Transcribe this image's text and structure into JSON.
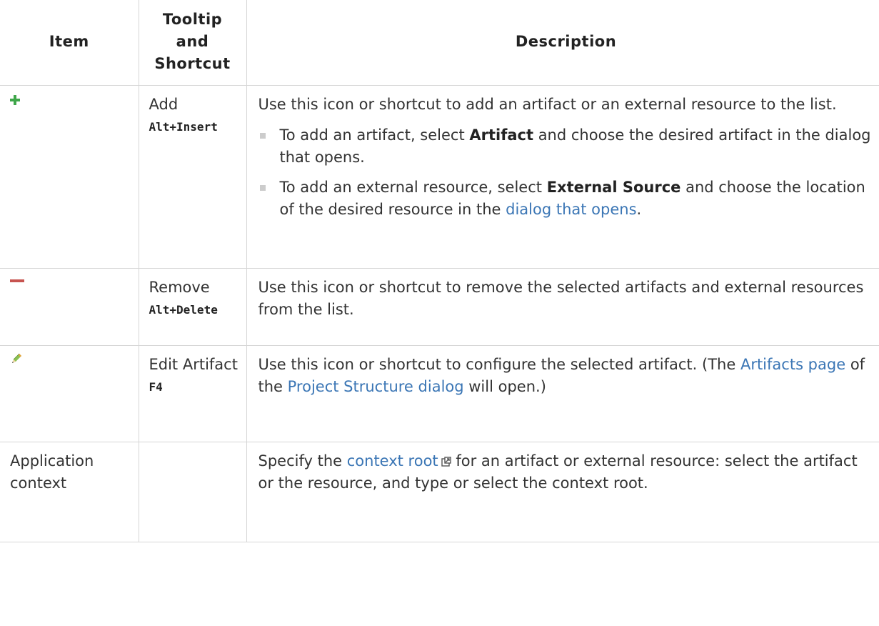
{
  "headers": {
    "item": "Item",
    "tooltip_lines": [
      "Tooltip",
      "and",
      "Shortcut"
    ],
    "description": "Description"
  },
  "icons": {
    "add": "plus-icon",
    "remove": "minus-icon",
    "edit": "pencil-icon",
    "external": "external-link-icon"
  },
  "colors": {
    "link": "#3b76b5",
    "add_icon": "#3fa64a",
    "remove_icon": "#c75450",
    "border": "#d6d6d6",
    "bullet": "#cccccc"
  },
  "rows": {
    "add": {
      "tooltip": "Add",
      "shortcut": "Alt+Insert",
      "description": "Use this icon or shortcut to add an artifact or an external resource to the list.",
      "bullet1": {
        "before": "To add an artifact, select ",
        "bold": "Artifact",
        "after": " and choose the desired artifact in the dialog that opens."
      },
      "bullet2": {
        "before": "To add an external resource, select ",
        "bold": "External Source",
        "middle": " and choose the location of the desired resource in the ",
        "link": "dialog that opens",
        "after": "."
      }
    },
    "remove": {
      "tooltip": "Remove",
      "shortcut": "Alt+Delete",
      "description": "Use this icon or shortcut to remove the selected artifacts and external resources from the list."
    },
    "edit": {
      "tooltip": "Edit Artifact",
      "shortcut": "F4",
      "desc_before": "Use this icon or shortcut to configure the selected artifact. (The ",
      "link1": "Artifacts page",
      "desc_middle": " of the ",
      "link2": "Project Structure dialog",
      "desc_after": " will open.)"
    },
    "app_context": {
      "item": "Application context",
      "desc_before": "Specify the ",
      "link": "context root",
      "desc_after": " for an artifact or external resource: select the artifact or the resource, and type or select the context root."
    }
  }
}
